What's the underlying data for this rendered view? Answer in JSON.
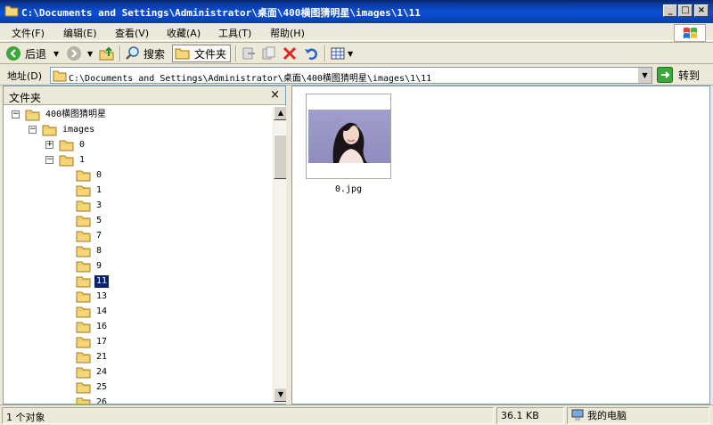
{
  "window": {
    "title": "C:\\Documents and Settings\\Administrator\\桌面\\400横图猜明星\\images\\1\\11"
  },
  "menu": [
    {
      "label": "文件(F)"
    },
    {
      "label": "编辑(E)"
    },
    {
      "label": "查看(V)"
    },
    {
      "label": "收藏(A)"
    },
    {
      "label": "工具(T)"
    },
    {
      "label": "帮助(H)"
    }
  ],
  "toolbar": {
    "back_label": "后退",
    "search_label": "搜索",
    "folders_label": "文件夹"
  },
  "address": {
    "label": "地址(D)",
    "path": "C:\\Documents and Settings\\Administrator\\桌面\\400横图猜明星\\images\\1\\11",
    "go_label": "转到"
  },
  "folder_pane": {
    "title": "文件夹",
    "close_glyph": "×",
    "tree": [
      {
        "label": "400横图猜明星",
        "expander": "−"
      },
      {
        "label": "images",
        "expander": "−"
      },
      {
        "label": "0",
        "expander": "+"
      },
      {
        "label": "1",
        "expander": "−"
      },
      {
        "label": "0"
      },
      {
        "label": "1"
      },
      {
        "label": "3"
      },
      {
        "label": "5"
      },
      {
        "label": "7"
      },
      {
        "label": "8"
      },
      {
        "label": "9"
      },
      {
        "label": "11",
        "selected": true
      },
      {
        "label": "13"
      },
      {
        "label": "14"
      },
      {
        "label": "16"
      },
      {
        "label": "17"
      },
      {
        "label": "21"
      },
      {
        "label": "24"
      },
      {
        "label": "25"
      },
      {
        "label": "26"
      }
    ]
  },
  "content": {
    "files": [
      {
        "name": "0.jpg"
      }
    ]
  },
  "status": {
    "objects": "1 个对象",
    "size": "36.1 KB",
    "zone": "我的电脑"
  }
}
